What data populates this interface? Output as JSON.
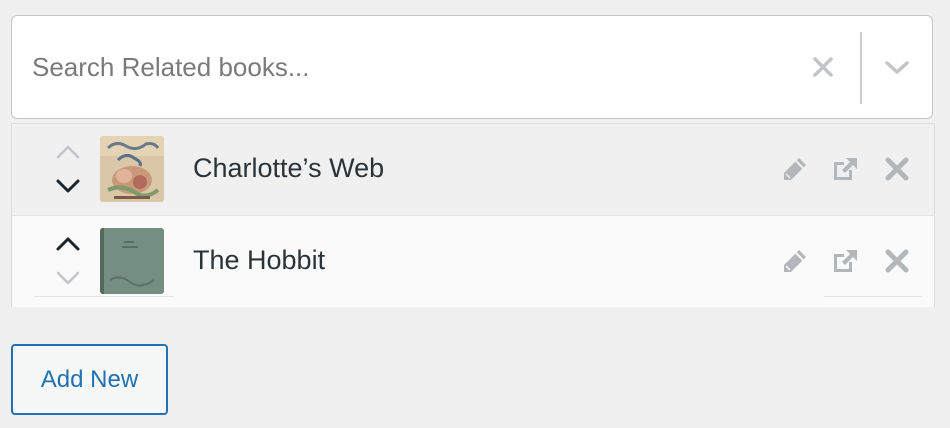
{
  "search": {
    "placeholder": "Search Related books...",
    "value": "",
    "clear_icon": "close-icon",
    "dropdown_icon": "chevron-down-icon"
  },
  "items": [
    {
      "title": "Charlotte’s Web",
      "thumbnail_icon": "book-cover-thumbnail",
      "actions": [
        "pencil-icon",
        "external-link-icon",
        "remove-icon"
      ]
    },
    {
      "title": "The Hobbit",
      "thumbnail_icon": "book-cover-thumbnail",
      "actions": [
        "pencil-icon",
        "external-link-icon",
        "remove-icon"
      ]
    }
  ],
  "add_button": {
    "label": "Add New"
  },
  "colors": {
    "page_bg": "#f0f0f1",
    "accent": "#2271b1",
    "text": "#2c3338",
    "icon_muted": "#a7aaad",
    "border": "#c3c4c7"
  }
}
